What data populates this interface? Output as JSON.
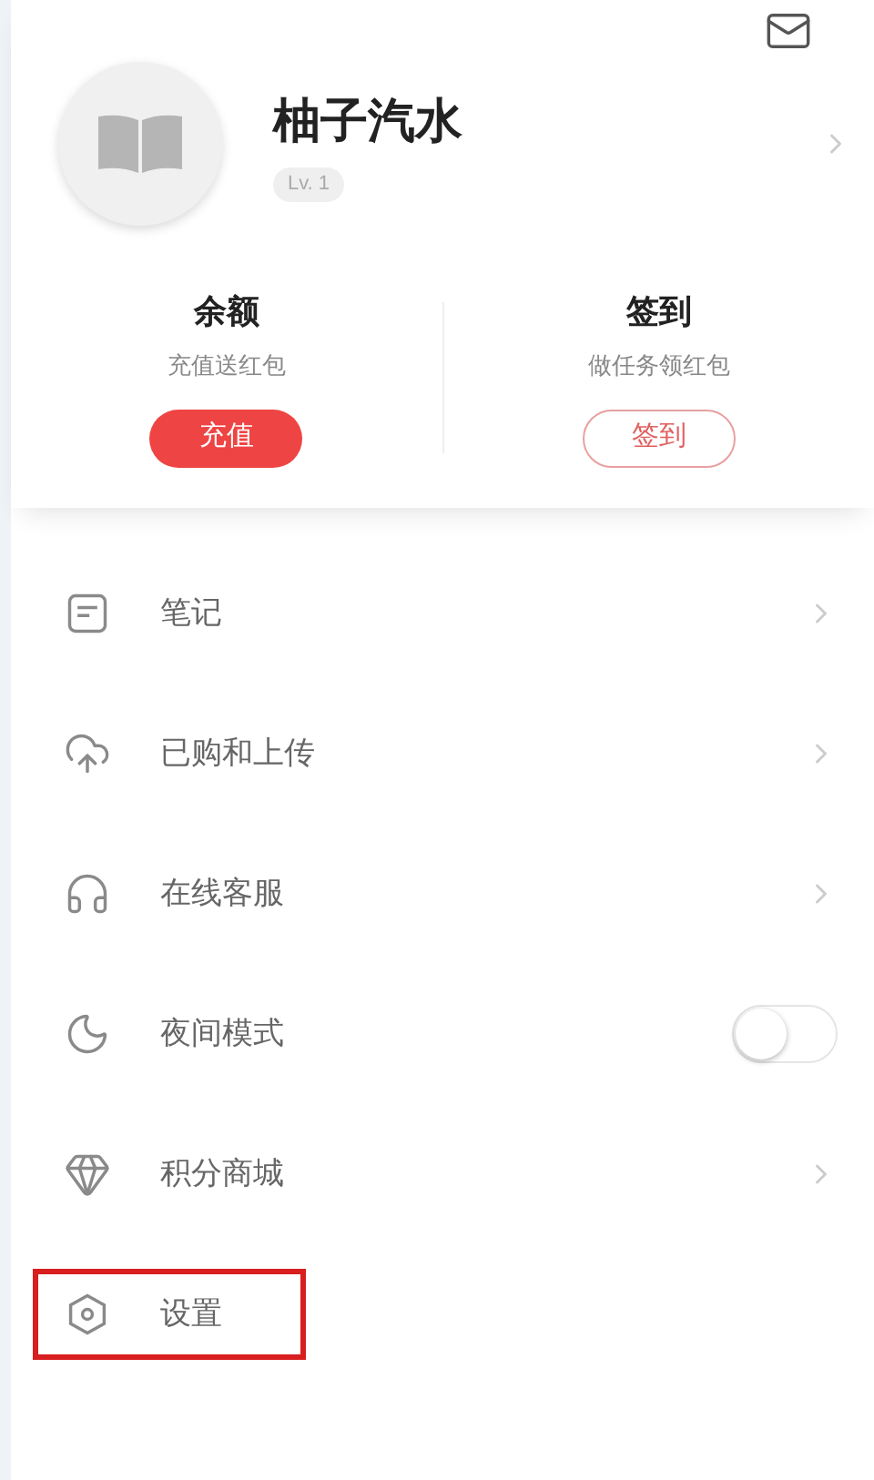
{
  "profile": {
    "name": "柚子汽水",
    "level_badge": "Lv. 1"
  },
  "stats": [
    {
      "title": "余额",
      "subtitle": "充值送红包",
      "button": "充值",
      "kind": "filled"
    },
    {
      "title": "签到",
      "subtitle": "做任务领红包",
      "button": "签到",
      "kind": "outline"
    }
  ],
  "menu": [
    {
      "label": "笔记",
      "kind": "link",
      "highlighted": false
    },
    {
      "label": "已购和上传",
      "kind": "link",
      "highlighted": false
    },
    {
      "label": "在线客服",
      "kind": "link",
      "highlighted": false
    },
    {
      "label": "夜间模式",
      "kind": "toggle",
      "on": false,
      "highlighted": false
    },
    {
      "label": "积分商城",
      "kind": "link",
      "highlighted": false
    },
    {
      "label": "设置",
      "kind": "plain",
      "highlighted": true
    }
  ]
}
